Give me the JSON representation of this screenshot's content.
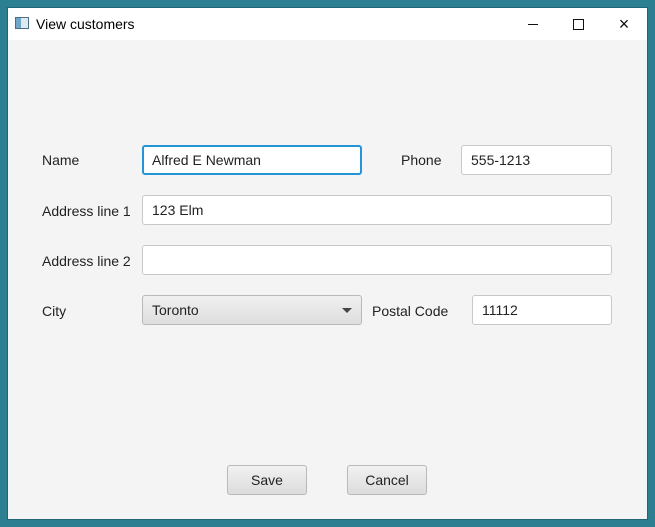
{
  "window": {
    "title": "View customers"
  },
  "form": {
    "name": {
      "label": "Name",
      "value": "Alfred E Newman"
    },
    "phone": {
      "label": "Phone",
      "value": "555-1213"
    },
    "address_line_1": {
      "label": "Address line 1",
      "value": "123 Elm"
    },
    "address_line_2": {
      "label": "Address line 2",
      "value": ""
    },
    "city": {
      "label": "City",
      "selected": "Toronto"
    },
    "postal_code": {
      "label": "Postal Code",
      "value": "11112"
    }
  },
  "actions": {
    "save_label": "Save",
    "cancel_label": "Cancel"
  },
  "colors": {
    "desktop": "#2b7f91",
    "focus_border": "#2496d8",
    "window_bg": "#f4f4f4"
  },
  "icons": {
    "app": "window-app-icon",
    "minimize": "minimize-icon",
    "maximize": "maximize-icon",
    "close": "close-icon",
    "dropdown": "chevron-down-icon"
  }
}
